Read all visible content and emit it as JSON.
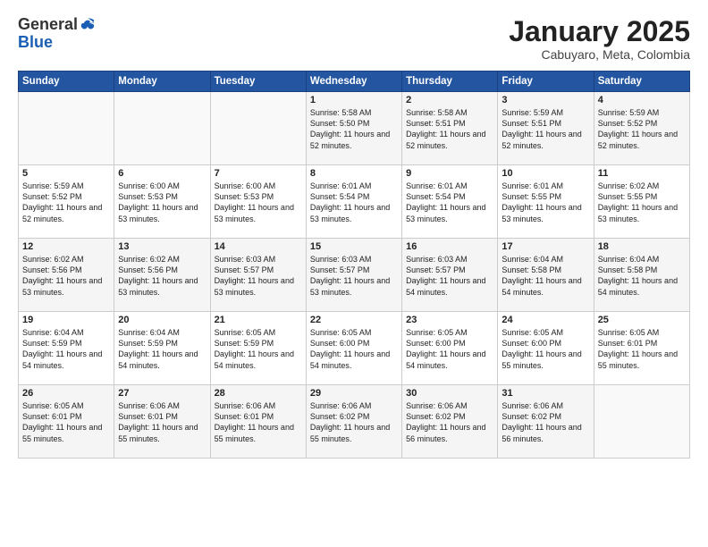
{
  "logo": {
    "general": "General",
    "blue": "Blue"
  },
  "header": {
    "month": "January 2025",
    "location": "Cabuyaro, Meta, Colombia"
  },
  "weekdays": [
    "Sunday",
    "Monday",
    "Tuesday",
    "Wednesday",
    "Thursday",
    "Friday",
    "Saturday"
  ],
  "weeks": [
    [
      {
        "day": "",
        "info": ""
      },
      {
        "day": "",
        "info": ""
      },
      {
        "day": "",
        "info": ""
      },
      {
        "day": "1",
        "info": "Sunrise: 5:58 AM\nSunset: 5:50 PM\nDaylight: 11 hours and 52 minutes."
      },
      {
        "day": "2",
        "info": "Sunrise: 5:58 AM\nSunset: 5:51 PM\nDaylight: 11 hours and 52 minutes."
      },
      {
        "day": "3",
        "info": "Sunrise: 5:59 AM\nSunset: 5:51 PM\nDaylight: 11 hours and 52 minutes."
      },
      {
        "day": "4",
        "info": "Sunrise: 5:59 AM\nSunset: 5:52 PM\nDaylight: 11 hours and 52 minutes."
      }
    ],
    [
      {
        "day": "5",
        "info": "Sunrise: 5:59 AM\nSunset: 5:52 PM\nDaylight: 11 hours and 52 minutes."
      },
      {
        "day": "6",
        "info": "Sunrise: 6:00 AM\nSunset: 5:53 PM\nDaylight: 11 hours and 53 minutes."
      },
      {
        "day": "7",
        "info": "Sunrise: 6:00 AM\nSunset: 5:53 PM\nDaylight: 11 hours and 53 minutes."
      },
      {
        "day": "8",
        "info": "Sunrise: 6:01 AM\nSunset: 5:54 PM\nDaylight: 11 hours and 53 minutes."
      },
      {
        "day": "9",
        "info": "Sunrise: 6:01 AM\nSunset: 5:54 PM\nDaylight: 11 hours and 53 minutes."
      },
      {
        "day": "10",
        "info": "Sunrise: 6:01 AM\nSunset: 5:55 PM\nDaylight: 11 hours and 53 minutes."
      },
      {
        "day": "11",
        "info": "Sunrise: 6:02 AM\nSunset: 5:55 PM\nDaylight: 11 hours and 53 minutes."
      }
    ],
    [
      {
        "day": "12",
        "info": "Sunrise: 6:02 AM\nSunset: 5:56 PM\nDaylight: 11 hours and 53 minutes."
      },
      {
        "day": "13",
        "info": "Sunrise: 6:02 AM\nSunset: 5:56 PM\nDaylight: 11 hours and 53 minutes."
      },
      {
        "day": "14",
        "info": "Sunrise: 6:03 AM\nSunset: 5:57 PM\nDaylight: 11 hours and 53 minutes."
      },
      {
        "day": "15",
        "info": "Sunrise: 6:03 AM\nSunset: 5:57 PM\nDaylight: 11 hours and 53 minutes."
      },
      {
        "day": "16",
        "info": "Sunrise: 6:03 AM\nSunset: 5:57 PM\nDaylight: 11 hours and 54 minutes."
      },
      {
        "day": "17",
        "info": "Sunrise: 6:04 AM\nSunset: 5:58 PM\nDaylight: 11 hours and 54 minutes."
      },
      {
        "day": "18",
        "info": "Sunrise: 6:04 AM\nSunset: 5:58 PM\nDaylight: 11 hours and 54 minutes."
      }
    ],
    [
      {
        "day": "19",
        "info": "Sunrise: 6:04 AM\nSunset: 5:59 PM\nDaylight: 11 hours and 54 minutes."
      },
      {
        "day": "20",
        "info": "Sunrise: 6:04 AM\nSunset: 5:59 PM\nDaylight: 11 hours and 54 minutes."
      },
      {
        "day": "21",
        "info": "Sunrise: 6:05 AM\nSunset: 5:59 PM\nDaylight: 11 hours and 54 minutes."
      },
      {
        "day": "22",
        "info": "Sunrise: 6:05 AM\nSunset: 6:00 PM\nDaylight: 11 hours and 54 minutes."
      },
      {
        "day": "23",
        "info": "Sunrise: 6:05 AM\nSunset: 6:00 PM\nDaylight: 11 hours and 54 minutes."
      },
      {
        "day": "24",
        "info": "Sunrise: 6:05 AM\nSunset: 6:00 PM\nDaylight: 11 hours and 55 minutes."
      },
      {
        "day": "25",
        "info": "Sunrise: 6:05 AM\nSunset: 6:01 PM\nDaylight: 11 hours and 55 minutes."
      }
    ],
    [
      {
        "day": "26",
        "info": "Sunrise: 6:05 AM\nSunset: 6:01 PM\nDaylight: 11 hours and 55 minutes."
      },
      {
        "day": "27",
        "info": "Sunrise: 6:06 AM\nSunset: 6:01 PM\nDaylight: 11 hours and 55 minutes."
      },
      {
        "day": "28",
        "info": "Sunrise: 6:06 AM\nSunset: 6:01 PM\nDaylight: 11 hours and 55 minutes."
      },
      {
        "day": "29",
        "info": "Sunrise: 6:06 AM\nSunset: 6:02 PM\nDaylight: 11 hours and 55 minutes."
      },
      {
        "day": "30",
        "info": "Sunrise: 6:06 AM\nSunset: 6:02 PM\nDaylight: 11 hours and 56 minutes."
      },
      {
        "day": "31",
        "info": "Sunrise: 6:06 AM\nSunset: 6:02 PM\nDaylight: 11 hours and 56 minutes."
      },
      {
        "day": "",
        "info": ""
      }
    ]
  ]
}
